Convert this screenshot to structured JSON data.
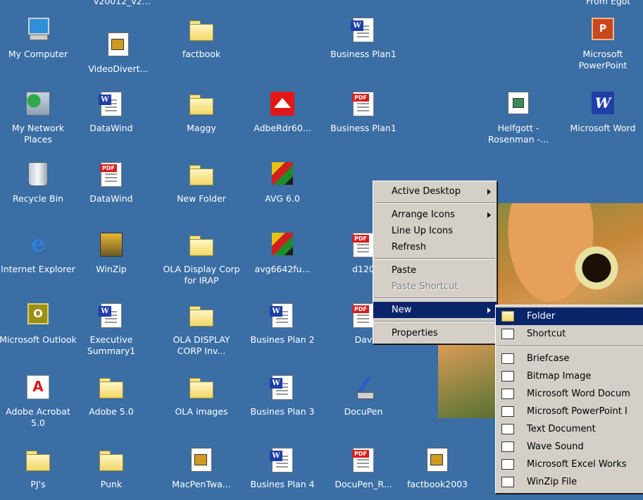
{
  "desktop": {
    "top_partial_labels": [
      "v20012_v2...",
      "From Egot"
    ],
    "icons": [
      {
        "name": "my-computer-icon",
        "label": "My Computer",
        "kind": "monitor"
      },
      {
        "name": "video-divert-icon",
        "label": "VideoDivert...",
        "kind": "video"
      },
      {
        "name": "factbook-folder-icon",
        "label": "factbook",
        "kind": "folder"
      },
      {
        "name": "business-plan1-word-icon",
        "label": "Business Plan1",
        "kind": "word"
      },
      {
        "name": "powerpoint-icon",
        "label": "Microsoft PowerPoint",
        "kind": "ppt"
      },
      {
        "name": "network-places-icon",
        "label": "My Network Places",
        "kind": "network"
      },
      {
        "name": "datawind-word-icon",
        "label": "DataWind",
        "kind": "word"
      },
      {
        "name": "maggy-folder-icon",
        "label": "Maggy",
        "kind": "folder"
      },
      {
        "name": "adbe-rdr-icon",
        "label": "AdbeRdr60...",
        "kind": "red"
      },
      {
        "name": "business-plan1-pdf-icon",
        "label": "Business Plan1",
        "kind": "pdf"
      },
      {
        "name": "helfgott-icon",
        "label": "Helfgott - Rosenman -...",
        "kind": "image"
      },
      {
        "name": "word-app-icon",
        "label": "Microsoft Word",
        "kind": "wordapp"
      },
      {
        "name": "recycle-bin-icon",
        "label": "Recycle Bin",
        "kind": "bin"
      },
      {
        "name": "datawind-pdf-icon",
        "label": "DataWind",
        "kind": "pdf"
      },
      {
        "name": "new-folder-icon",
        "label": "New Folder",
        "kind": "folder"
      },
      {
        "name": "avg-icon",
        "label": "AVG 6.0",
        "kind": "avg"
      },
      {
        "name": "internet-explorer-icon",
        "label": "Internet Explorer",
        "kind": "ie"
      },
      {
        "name": "winzip-icon",
        "label": "WinZip",
        "kind": "winzip"
      },
      {
        "name": "ola-display-folder-icon",
        "label": "OLA Display Corp for IRAP",
        "kind": "folder"
      },
      {
        "name": "avg6642-icon",
        "label": "avg6642fu...",
        "kind": "avg"
      },
      {
        "name": "d120-pdf-icon",
        "label": "d120",
        "kind": "pdf"
      },
      {
        "name": "outlook-icon",
        "label": "Microsoft Outlook",
        "kind": "outlook"
      },
      {
        "name": "executive-summary-icon",
        "label": "Executive Summary1",
        "kind": "word"
      },
      {
        "name": "ola-display-inv-folder-icon",
        "label": "OLA DISPLAY CORP Inv...",
        "kind": "folder"
      },
      {
        "name": "busines-plan2-icon",
        "label": "Busines Plan 2",
        "kind": "word"
      },
      {
        "name": "dav-pdf-icon",
        "label": "Dav",
        "kind": "pdf"
      },
      {
        "name": "acrobat-icon",
        "label": "Adobe Acrobat 5.0",
        "kind": "acrobat"
      },
      {
        "name": "adobe5-folder-icon",
        "label": "Adobe 5.0",
        "kind": "folder"
      },
      {
        "name": "ola-images-folder-icon",
        "label": "OLA images",
        "kind": "folder"
      },
      {
        "name": "busines-plan3-icon",
        "label": "Busines Plan 3",
        "kind": "word"
      },
      {
        "name": "docupen-icon",
        "label": "DocuPen",
        "kind": "pen"
      },
      {
        "name": "pjs-folder-icon",
        "label": "PJ's",
        "kind": "folder"
      },
      {
        "name": "punk-folder-icon",
        "label": "Punk",
        "kind": "folder"
      },
      {
        "name": "macpentwa-icon",
        "label": "MacPenTwa...",
        "kind": "video"
      },
      {
        "name": "busines-plan4-icon",
        "label": "Busines Plan 4",
        "kind": "word"
      },
      {
        "name": "docupen-r-pdf-icon",
        "label": "DocuPen_R...",
        "kind": "pdf"
      },
      {
        "name": "factbook2003-icon",
        "label": "factbook2003",
        "kind": "video"
      }
    ]
  },
  "context_menu": {
    "items": [
      {
        "label": "Active Desktop",
        "submenu": true
      },
      {
        "sep": true
      },
      {
        "label": "Arrange Icons",
        "submenu": true
      },
      {
        "label": "Line Up Icons"
      },
      {
        "label": "Refresh"
      },
      {
        "sep": true
      },
      {
        "label": "Paste"
      },
      {
        "label": "Paste Shortcut",
        "disabled": true
      },
      {
        "sep": true
      },
      {
        "label": "New",
        "submenu": true,
        "active": true
      },
      {
        "sep": true
      },
      {
        "label": "Properties"
      }
    ]
  },
  "new_submenu": {
    "items": [
      {
        "label": "Folder",
        "icon": "folder-icon",
        "active": true
      },
      {
        "label": "Shortcut",
        "icon": "shortcut-icon"
      },
      {
        "sep": true
      },
      {
        "label": "Briefcase",
        "icon": "briefcase-icon"
      },
      {
        "label": "Bitmap Image",
        "icon": "bitmap-icon"
      },
      {
        "label": "Microsoft Word Docum",
        "icon": "word-doc-icon"
      },
      {
        "label": "Microsoft PowerPoint I",
        "icon": "ppt-doc-icon"
      },
      {
        "label": "Text Document",
        "icon": "text-doc-icon"
      },
      {
        "label": "Wave Sound",
        "icon": "wave-sound-icon"
      },
      {
        "label": "Microsoft Excel Works",
        "icon": "excel-icon"
      },
      {
        "label": "WinZip File",
        "icon": "winzip-file-icon"
      }
    ]
  },
  "colors": {
    "desktop": "#3a6ea5",
    "menu": "#d4d0c8",
    "highlight": "#0a246a"
  }
}
